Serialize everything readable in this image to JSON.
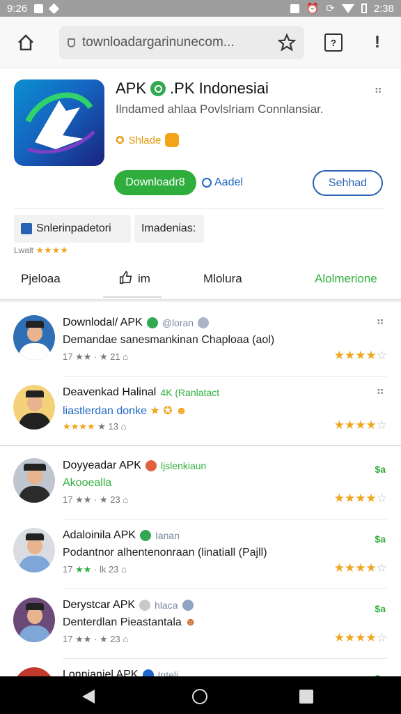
{
  "status_bar": {
    "time_left": "9:26",
    "time_right": "2:38"
  },
  "browser": {
    "url": "townloadargarinunecom...",
    "home_icon": "home-icon",
    "star_icon": "star-icon",
    "tab_count": "?",
    "menu": "!"
  },
  "app": {
    "title_a": "APK",
    "title_b": ".PK Indonesiai",
    "subtitle": "Ilndamed ahlaa Povlslriam Connlansiar.",
    "developer": "Shlade",
    "download_label": "Downloadr8",
    "add_label": "Aadel",
    "share_label": "Sehhad",
    "chip1": "Snlerinpadetori",
    "chip2": "Imadenias:",
    "rating_prefix": "Lwalt",
    "rating_stars": "★★★★"
  },
  "tabs": [
    {
      "label": "Pjeloaa"
    },
    {
      "label": "im"
    },
    {
      "label": "Mlolura"
    },
    {
      "label": "Alolmerione"
    }
  ],
  "items": [
    {
      "title": "Downlodal/ APK",
      "tag": "@loran",
      "desc": "Demandae sanesmankinan Chaploaa (aol)",
      "meta_a": "17",
      "meta_b": "21",
      "stars": "★★★★",
      "empty": "☆",
      "right": "⋮⋮"
    },
    {
      "title": "Deavenkad Halinal",
      "tag": "4K (Ranlatact",
      "desc": "liastlerdan donke",
      "meta_a": "★★★★",
      "meta_b": "13",
      "stars": "★★★★",
      "empty": "☆",
      "right": "⋮⋮"
    },
    {
      "title": "Doyyeadar APK",
      "tag": "ljslenkiaun",
      "desc": "Akooealla",
      "meta_a": "17",
      "meta_b": "23",
      "stars": "★★★★",
      "empty": "☆",
      "right": "$a"
    },
    {
      "title": "Adaloinila APK",
      "tag": "Ianan",
      "desc": "Podantnor alhentenonraan (linatiall (Pajll)",
      "meta_a": "17",
      "meta_b": "lk 23",
      "stars": "★★★★",
      "empty": "☆",
      "right": "$a"
    },
    {
      "title": "Derystcar APK",
      "tag": "hlaca",
      "desc": "Denterdlan Pieastantala",
      "meta_a": "17",
      "meta_b": "23",
      "stars": "★★★★",
      "empty": "☆",
      "right": "$a"
    },
    {
      "title": "Lonnianiel APK",
      "tag": "Inteli",
      "desc": "",
      "meta_a": "",
      "meta_b": "",
      "stars": "",
      "empty": "",
      "right": "$a"
    }
  ]
}
